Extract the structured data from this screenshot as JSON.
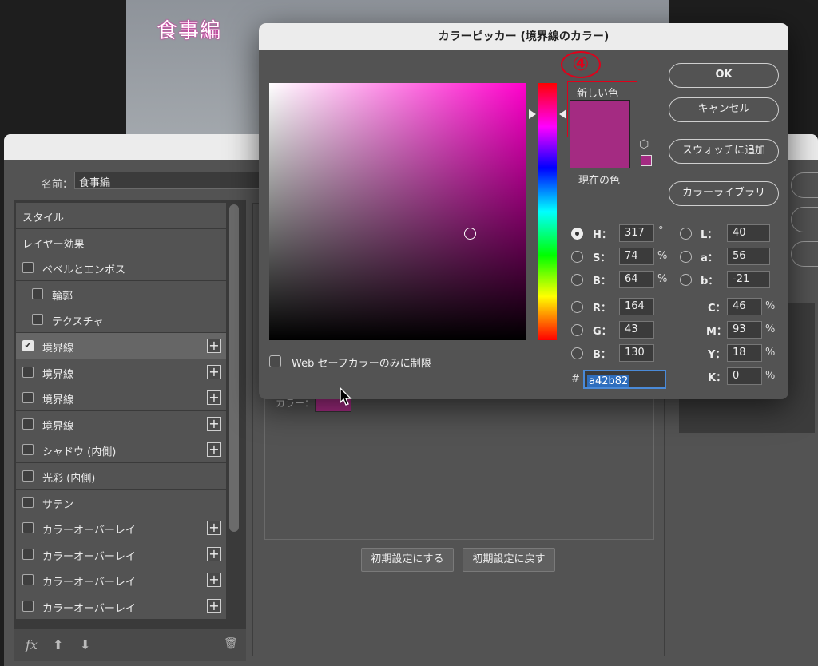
{
  "document": {
    "title": "食事編"
  },
  "layer_style": {
    "name_label": "名前：",
    "name_value": "食事編",
    "items": [
      {
        "label": "スタイル",
        "checkbox": false,
        "checked": false,
        "plus": false,
        "indent": false,
        "selected": false
      },
      {
        "label": "レイヤー効果",
        "checkbox": false,
        "checked": false,
        "plus": false,
        "indent": false,
        "selected": false
      },
      {
        "label": "ベベルとエンボス",
        "checkbox": true,
        "checked": false,
        "plus": false,
        "indent": false,
        "selected": false
      },
      {
        "label": "輪郭",
        "checkbox": true,
        "checked": false,
        "plus": false,
        "indent": true,
        "selected": false
      },
      {
        "label": "テクスチャ",
        "checkbox": true,
        "checked": false,
        "plus": false,
        "indent": true,
        "selected": false
      },
      {
        "label": "境界線",
        "checkbox": true,
        "checked": true,
        "plus": true,
        "indent": false,
        "selected": true
      },
      {
        "label": "境界線",
        "checkbox": true,
        "checked": false,
        "plus": true,
        "indent": false,
        "selected": false
      },
      {
        "label": "境界線",
        "checkbox": true,
        "checked": false,
        "plus": true,
        "indent": false,
        "selected": false
      },
      {
        "label": "境界線",
        "checkbox": true,
        "checked": false,
        "plus": true,
        "indent": false,
        "selected": false
      },
      {
        "label": "シャドウ (内側)",
        "checkbox": true,
        "checked": false,
        "plus": true,
        "indent": false,
        "selected": false
      },
      {
        "label": "光彩 (内側)",
        "checkbox": true,
        "checked": false,
        "plus": false,
        "indent": false,
        "selected": false
      },
      {
        "label": "サテン",
        "checkbox": true,
        "checked": false,
        "plus": false,
        "indent": false,
        "selected": false
      },
      {
        "label": "カラーオーバーレイ",
        "checkbox": true,
        "checked": false,
        "plus": true,
        "indent": false,
        "selected": false
      },
      {
        "label": "カラーオーバーレイ",
        "checkbox": true,
        "checked": false,
        "plus": true,
        "indent": false,
        "selected": false
      },
      {
        "label": "カラーオーバーレイ",
        "checkbox": true,
        "checked": false,
        "plus": true,
        "indent": false,
        "selected": false
      },
      {
        "label": "カラーオーバーレイ",
        "checkbox": true,
        "checked": false,
        "plus": true,
        "indent": false,
        "selected": false
      }
    ],
    "footer": {
      "fx": "fx",
      "up": "⬆",
      "down": "⬇",
      "trash": "🗑"
    },
    "color_label": "カラー：",
    "stroke_color": "#a42b82",
    "btn_default": "初期設定にする",
    "btn_reset": "初期設定に戻す"
  },
  "color_picker": {
    "title": "カラーピッカー (境界線のカラー)",
    "new_label": "新しい色",
    "current_label": "現在の色",
    "new_color": "#a42b82",
    "current_color": "#a42b82",
    "annotation": "④",
    "buttons": {
      "ok": "OK",
      "cancel": "キャンセル",
      "add_swatch": "スウォッチに追加",
      "library": "カラーライブラリ"
    },
    "web_safe_label": "Web セーフカラーのみに制限",
    "fields": {
      "H": {
        "label": "H：",
        "value": "317",
        "unit": "°"
      },
      "S": {
        "label": "S：",
        "value": "74",
        "unit": "%"
      },
      "Bv": {
        "label": "B：",
        "value": "64",
        "unit": "%"
      },
      "R": {
        "label": "R：",
        "value": "164"
      },
      "G": {
        "label": "G：",
        "value": "43"
      },
      "Bc": {
        "label": "B：",
        "value": "130"
      },
      "L": {
        "label": "L：",
        "value": "40"
      },
      "a": {
        "label": "a：",
        "value": "56"
      },
      "b": {
        "label": "b：",
        "value": "-21"
      },
      "C": {
        "label": "C：",
        "value": "46",
        "unit": "%"
      },
      "M": {
        "label": "M：",
        "value": "93",
        "unit": "%"
      },
      "Y": {
        "label": "Y：",
        "value": "18",
        "unit": "%"
      },
      "K": {
        "label": "K：",
        "value": "0",
        "unit": "%"
      }
    },
    "hash_label": "#",
    "hex": "a42b82"
  }
}
